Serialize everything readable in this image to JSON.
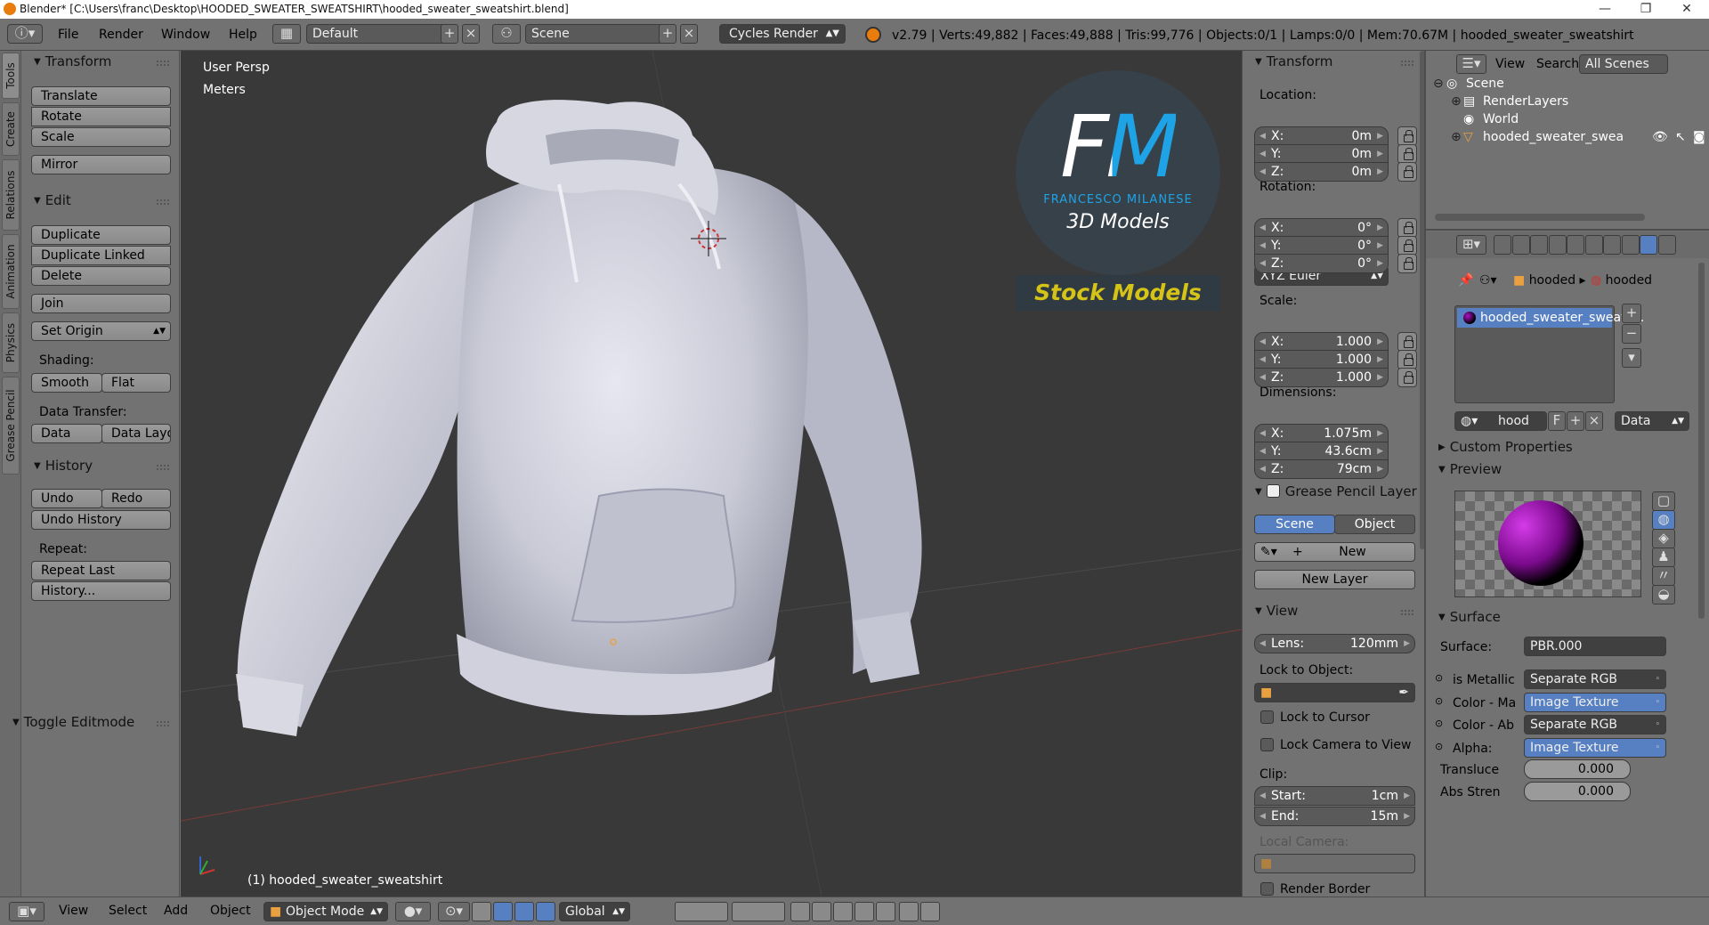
{
  "window": {
    "title": "Blender* [C:\\Users\\franc\\Desktop\\HOODED_SWEATER_SWEATSHIRT\\hooded_sweater_sweatshirt.blend]",
    "minimize": "—",
    "maximize": "❐",
    "close": "✕"
  },
  "info_header": {
    "menus": [
      "File",
      "Render",
      "Window",
      "Help"
    ],
    "screen_layout": "Default",
    "scene": "Scene",
    "render_engine": "Cycles Render",
    "stats": "v2.79 | Verts:49,882 | Faces:49,888 | Tris:99,776 | Objects:0/1 | Lamps:0/0 | Mem:70.67M | hooded_sweater_sweatshirt"
  },
  "tool_tabs": [
    "Tools",
    "Create",
    "Relations",
    "Animation",
    "Physics",
    "Grease Pencil"
  ],
  "tool_shelf": {
    "transform": {
      "title": "Transform",
      "translate": "Translate",
      "rotate": "Rotate",
      "scale": "Scale",
      "mirror": "Mirror"
    },
    "edit": {
      "title": "Edit",
      "duplicate": "Duplicate",
      "duplicate_linked": "Duplicate Linked",
      "delete": "Delete",
      "join": "Join",
      "set_origin": "Set Origin",
      "shading_label": "Shading:",
      "smooth": "Smooth",
      "flat": "Flat",
      "data_transfer_label": "Data Transfer:",
      "data": "Data",
      "data_layout": "Data Layo"
    },
    "history": {
      "title": "History",
      "undo": "Undo",
      "redo": "Redo",
      "undo_history": "Undo History",
      "repeat_label": "Repeat:",
      "repeat_last": "Repeat Last",
      "history_btn": "History..."
    },
    "toggle_editmode": "Toggle Editmode"
  },
  "viewport": {
    "view_name": "User Persp",
    "units": "Meters",
    "object_label": "(1) hooded_sweater_sweatshirt",
    "watermark": {
      "monogram": "FM",
      "author": "FRANCESCO MILANESE",
      "tagline": "3D Models",
      "banner": "Stock Models"
    }
  },
  "n_panel": {
    "transform_title": "Transform",
    "location_label": "Location:",
    "location": [
      {
        "k": "X:",
        "v": "0m"
      },
      {
        "k": "Y:",
        "v": "0m"
      },
      {
        "k": "Z:",
        "v": "0m"
      }
    ],
    "rotation_label": "Rotation:",
    "rotation": [
      {
        "k": "X:",
        "v": "0°"
      },
      {
        "k": "Y:",
        "v": "0°"
      },
      {
        "k": "Z:",
        "v": "0°"
      }
    ],
    "rotation_mode": "XYZ Euler",
    "scale_label": "Scale:",
    "scale": [
      {
        "k": "X:",
        "v": "1.000"
      },
      {
        "k": "Y:",
        "v": "1.000"
      },
      {
        "k": "Z:",
        "v": "1.000"
      }
    ],
    "dimensions_label": "Dimensions:",
    "dimensions": [
      {
        "k": "X:",
        "v": "1.075m"
      },
      {
        "k": "Y:",
        "v": "43.6cm"
      },
      {
        "k": "Z:",
        "v": "79cm"
      }
    ],
    "grease_pencil_title": "Grease Pencil Layer",
    "gp_scene": "Scene",
    "gp_object": "Object",
    "gp_new": "New",
    "gp_new_layer": "New Layer",
    "view_title": "View",
    "lens_label": "Lens:",
    "lens_value": "120mm",
    "lock_to_object_label": "Lock to Object:",
    "lock_to_cursor": "Lock to Cursor",
    "lock_camera": "Lock Camera to View",
    "clip_label": "Clip:",
    "clip_start_label": "Start:",
    "clip_start": "1cm",
    "clip_end_label": "End:",
    "clip_end": "15m",
    "local_camera_label": "Local Camera:",
    "render_border": "Render Border"
  },
  "outliner": {
    "view": "View",
    "search": "Search",
    "filter": "All Scenes",
    "rows": [
      "Scene",
      "RenderLayers",
      "World",
      "hooded_sweater_swea"
    ]
  },
  "properties": {
    "breadcrumb": [
      "hooded",
      "hooded"
    ],
    "material_slot": "hooded_sweater_sweats...",
    "mat_name": "hood",
    "mat_f": "F",
    "link": "Data",
    "custom_props": "Custom Properties",
    "preview": "Preview",
    "surface_title": "Surface",
    "surface_label": "Surface:",
    "surface_value": "PBR.000",
    "inputs": [
      {
        "label": "is Metallic",
        "value": "Separate RGB"
      },
      {
        "label": "Color - Ma",
        "value": "Image Texture"
      },
      {
        "label": "Color - Ab",
        "value": "Separate RGB"
      },
      {
        "label": "Alpha:",
        "value": "Image Texture"
      }
    ],
    "translucency_label": "Transluce",
    "translucency": "0.000",
    "abs_label": "Abs Stren",
    "abs_value": "0.000"
  },
  "status_bar": {
    "menus": [
      "View",
      "Select",
      "Add",
      "Object"
    ],
    "mode": "Object Mode",
    "orientation": "Global"
  },
  "colors": {
    "accent": "#5680c2",
    "panel": "#727272",
    "viewport": "#393939",
    "material_purple": "#b012c8"
  }
}
